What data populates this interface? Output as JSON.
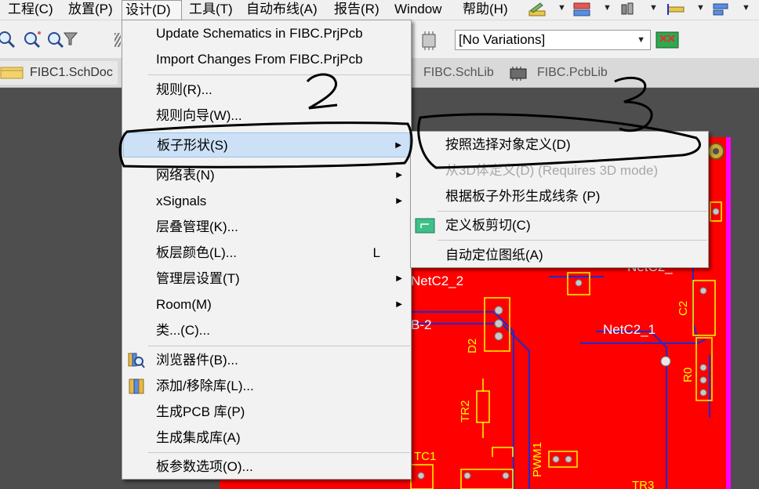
{
  "menubar": {
    "items": [
      {
        "label": "工程(C)"
      },
      {
        "label": "放置(P)"
      },
      {
        "label": "设计(D)"
      },
      {
        "label": "工具(T)"
      },
      {
        "label": "自动布线(A)"
      },
      {
        "label": "报告(R)"
      },
      {
        "label": "Window"
      },
      {
        "label": "帮助(H)"
      }
    ]
  },
  "toolbar": {
    "variations_value": "[No Variations]"
  },
  "tabs": [
    {
      "label": "FIBC1.SchDoc",
      "icon": "schematic-doc-icon"
    },
    {
      "label": "FIBC.SchLib",
      "icon": "schematic-lib-icon"
    },
    {
      "label": "FIBC.PcbLib",
      "icon": "pcb-lib-icon"
    }
  ],
  "design_menu": {
    "items": [
      {
        "label": "Update Schematics in FIBC.PrjPcb"
      },
      {
        "label": "Import Changes From FIBC.PrjPcb"
      },
      {
        "label": "规则(R)..."
      },
      {
        "label": "规则向导(W)..."
      },
      {
        "label": "板子形状(S)"
      },
      {
        "label": "网络表(N)"
      },
      {
        "label": "xSignals"
      },
      {
        "label": "层叠管理(K)..."
      },
      {
        "label": "板层颜色(L)...",
        "shortcut": "L"
      },
      {
        "label": "管理层设置(T)"
      },
      {
        "label": "Room(M)"
      },
      {
        "label": "类...(C)..."
      },
      {
        "label": "浏览器件(B)..."
      },
      {
        "label": "添加/移除库(L)..."
      },
      {
        "label": "生成PCB 库(P)"
      },
      {
        "label": "生成集成库(A)"
      },
      {
        "label": "板参数选项(O)..."
      }
    ]
  },
  "board_shape_submenu": {
    "items": [
      {
        "label": "按照选择对象定义(D)"
      },
      {
        "label": "从3D体定义(D) (Requires 3D mode)",
        "disabled": true
      },
      {
        "label": "根据板子外形生成线条 (P)"
      },
      {
        "label": "定义板剪切(C)"
      },
      {
        "label": "自动定位图纸(A)"
      }
    ]
  },
  "pcb": {
    "labels": [
      "NetC2_2",
      "NetC2_1",
      "B-2",
      "D2",
      "C2",
      "R0",
      "TR2",
      "TC1",
      "PWM1",
      "TR3",
      "NetC2_"
    ]
  },
  "annotations": {
    "marks": [
      "2",
      "3"
    ]
  },
  "colors": {
    "pcb_red": "#ff0000",
    "pcb_blue_trace": "#1c2bd0",
    "pcb_yellow": "#ffff00",
    "menu_highlight": "#cce1f6"
  }
}
